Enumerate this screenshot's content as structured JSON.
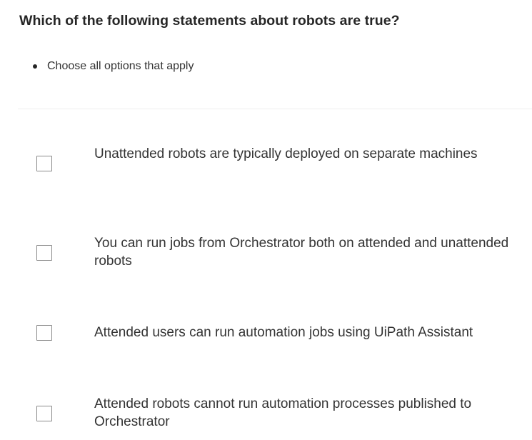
{
  "question": {
    "title": "Which of the following statements about robots are true?",
    "instructions": [
      "Choose all options that apply"
    ]
  },
  "options": [
    {
      "label": "Unattended robots are typically deployed on separate machines",
      "checked": false
    },
    {
      "label": "You can run jobs from Orchestrator both on attended and unattended robots",
      "checked": false
    },
    {
      "label": "Attended users can run automation jobs using UiPath Assistant",
      "checked": false
    },
    {
      "label": "Attended robots cannot run automation processes published to Orchestrator",
      "checked": false
    }
  ],
  "colors": {
    "text": "#333333",
    "title": "#262626",
    "checkbox_border": "#8a8a8a",
    "divider": "#eeeeee"
  }
}
